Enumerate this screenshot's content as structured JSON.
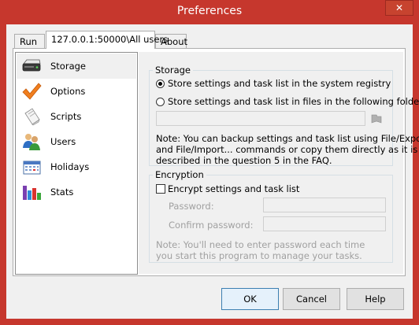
{
  "window": {
    "title": "Preferences",
    "close_symbol": "✕"
  },
  "tabs": [
    {
      "label": "Run"
    },
    {
      "label": "127.0.0.1:50000\\All users"
    },
    {
      "label": "About"
    }
  ],
  "sidebar": {
    "items": [
      {
        "label": "Storage",
        "icon": "hard-drive-icon"
      },
      {
        "label": "Options",
        "icon": "checkmark-icon"
      },
      {
        "label": "Scripts",
        "icon": "script-icon"
      },
      {
        "label": "Users",
        "icon": "users-icon"
      },
      {
        "label": "Holidays",
        "icon": "calendar-icon"
      },
      {
        "label": "Stats",
        "icon": "bar-chart-icon"
      }
    ]
  },
  "storage": {
    "legend": "Storage",
    "option_registry": "Store settings and task list in the system registry",
    "option_files": "Store settings and task list in files in the following folder:",
    "selected": "registry",
    "folder_value": "",
    "note_lines": [
      "Note: You can backup settings and task list using File/Export...",
      "and File/Import... commands or copy them directly as it is",
      "described in the question 5 in the FAQ."
    ]
  },
  "encryption": {
    "legend": "Encryption",
    "checkbox_label": "Encrypt settings and task list",
    "checked": false,
    "password_label": "Password:",
    "confirm_label": "Confirm password:",
    "password_value": "",
    "confirm_value": "",
    "note_lines": [
      "Note: You'll need to enter password each time",
      "you start this program to manage your tasks."
    ]
  },
  "buttons": {
    "ok": "OK",
    "cancel": "Cancel",
    "help": "Help"
  }
}
